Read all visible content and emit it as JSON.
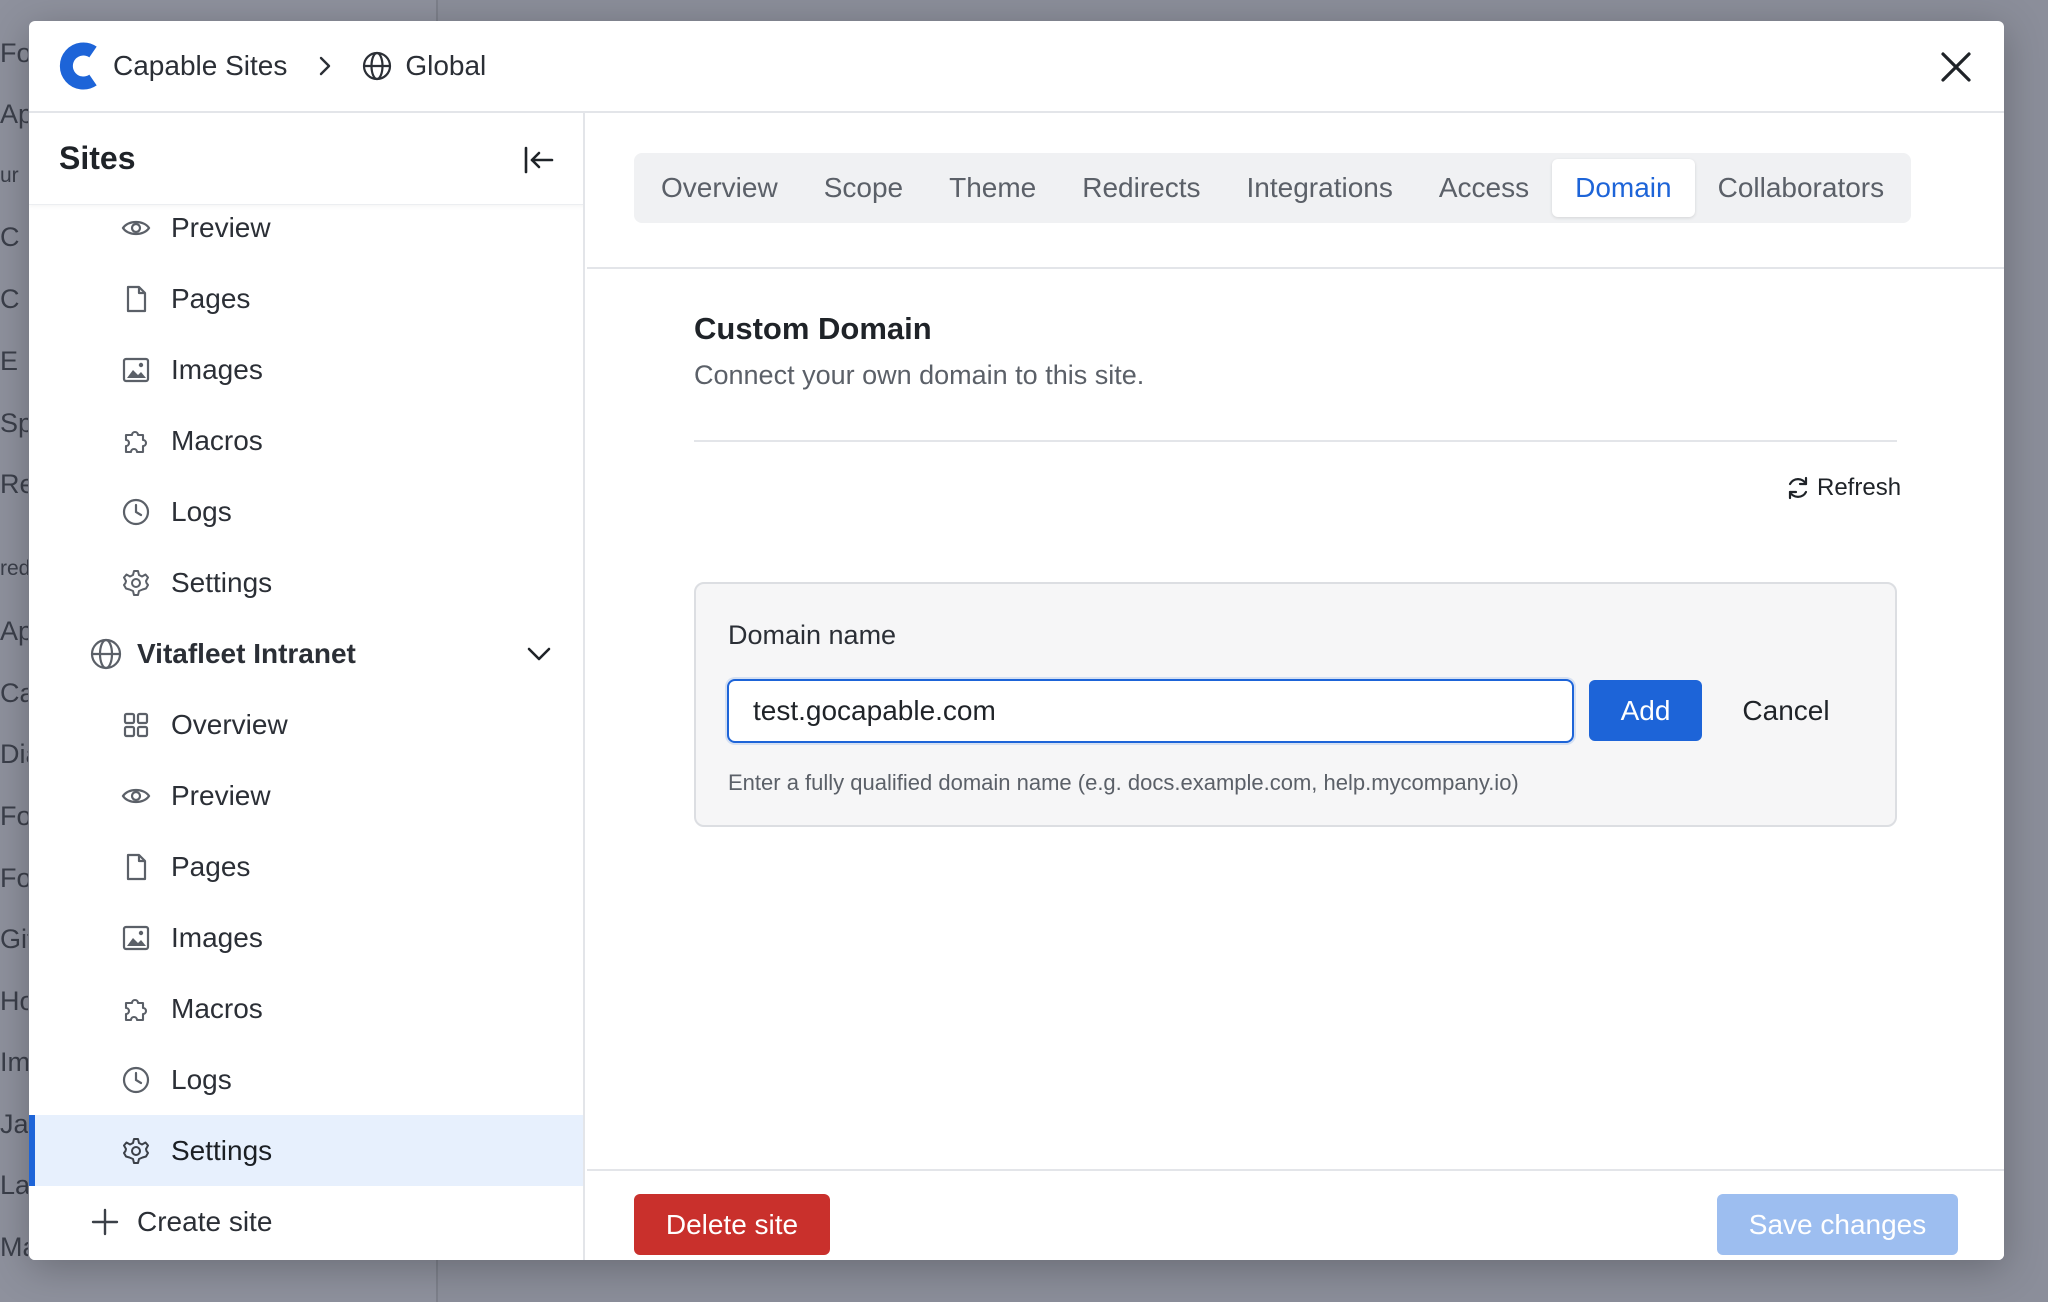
{
  "background": {
    "fragments": [
      "Fo",
      "Ap",
      "ur",
      "C",
      "C",
      "E",
      "Sp",
      "Re",
      "red",
      "Ap",
      "Ca",
      "Dia",
      "Fo",
      "Fo",
      "Git",
      "Ho",
      "Im",
      "Ja",
      "La",
      "Ma"
    ]
  },
  "header": {
    "app_name": "Capable Sites",
    "scope_name": "Global",
    "icons": {
      "logo": "capable-logo-icon",
      "separator": "chevron-right-icon",
      "scope": "globe-icon",
      "close": "close-icon"
    }
  },
  "sidebar": {
    "title": "Sites",
    "collapse_icon": "collapse-left-icon",
    "items": [
      {
        "label": "Preview",
        "icon": "eye-icon"
      },
      {
        "label": "Pages",
        "icon": "file-icon"
      },
      {
        "label": "Images",
        "icon": "image-icon"
      },
      {
        "label": "Macros",
        "icon": "puzzle-icon"
      },
      {
        "label": "Logs",
        "icon": "clock-icon"
      },
      {
        "label": "Settings",
        "icon": "gear-icon"
      }
    ],
    "site": {
      "name": "Vitafleet Intranet",
      "icon": "globe-icon",
      "expanded": true
    },
    "site_items": [
      {
        "label": "Overview",
        "icon": "grid-icon"
      },
      {
        "label": "Preview",
        "icon": "eye-icon"
      },
      {
        "label": "Pages",
        "icon": "file-icon"
      },
      {
        "label": "Images",
        "icon": "image-icon"
      },
      {
        "label": "Macros",
        "icon": "puzzle-icon"
      },
      {
        "label": "Logs",
        "icon": "clock-icon"
      },
      {
        "label": "Settings",
        "icon": "gear-icon",
        "active": true
      }
    ],
    "create_label": "Create site"
  },
  "tabs": [
    {
      "label": "Overview"
    },
    {
      "label": "Scope"
    },
    {
      "label": "Theme"
    },
    {
      "label": "Redirects"
    },
    {
      "label": "Integrations"
    },
    {
      "label": "Access"
    },
    {
      "label": "Domain",
      "active": true
    },
    {
      "label": "Collaborators"
    }
  ],
  "domain": {
    "title": "Custom Domain",
    "subtitle": "Connect your own domain to this site.",
    "refresh_label": "Refresh",
    "field_label": "Domain name",
    "value": "test.gocapable.com",
    "add_label": "Add",
    "cancel_label": "Cancel",
    "help": "Enter a fully qualified domain name (e.g. docs.example.com, help.mycompany.io)"
  },
  "footer": {
    "delete_label": "Delete site",
    "save_label": "Save changes"
  },
  "colors": {
    "accent": "#1d64d8",
    "danger": "#c9302c",
    "save_disabled": "#9dbef0",
    "active_row": "#e7f0fd"
  }
}
